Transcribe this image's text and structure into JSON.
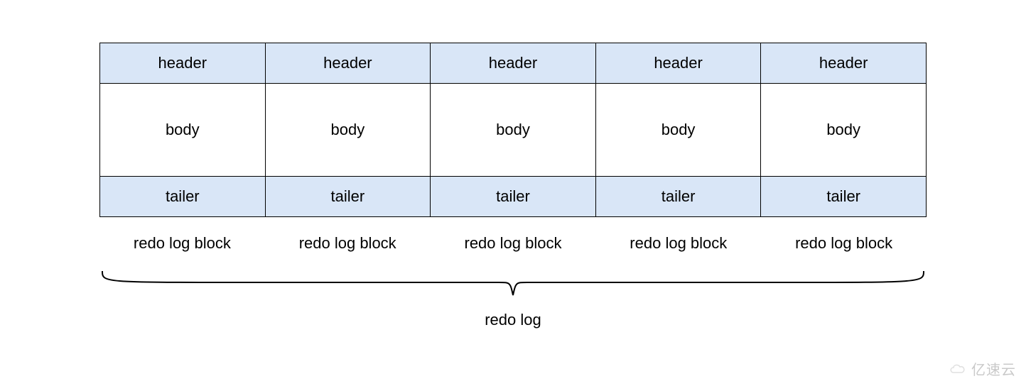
{
  "diagram": {
    "block_count": 5,
    "sections": {
      "header": "header",
      "body": "body",
      "tailer": "tailer"
    },
    "block_caption": "redo log block",
    "overall_label": "redo log",
    "colors": {
      "header_bg": "#d9e6f7",
      "tailer_bg": "#d9e6f7",
      "body_bg": "#ffffff",
      "border": "#000000"
    }
  },
  "watermark": {
    "text": "亿速云"
  }
}
